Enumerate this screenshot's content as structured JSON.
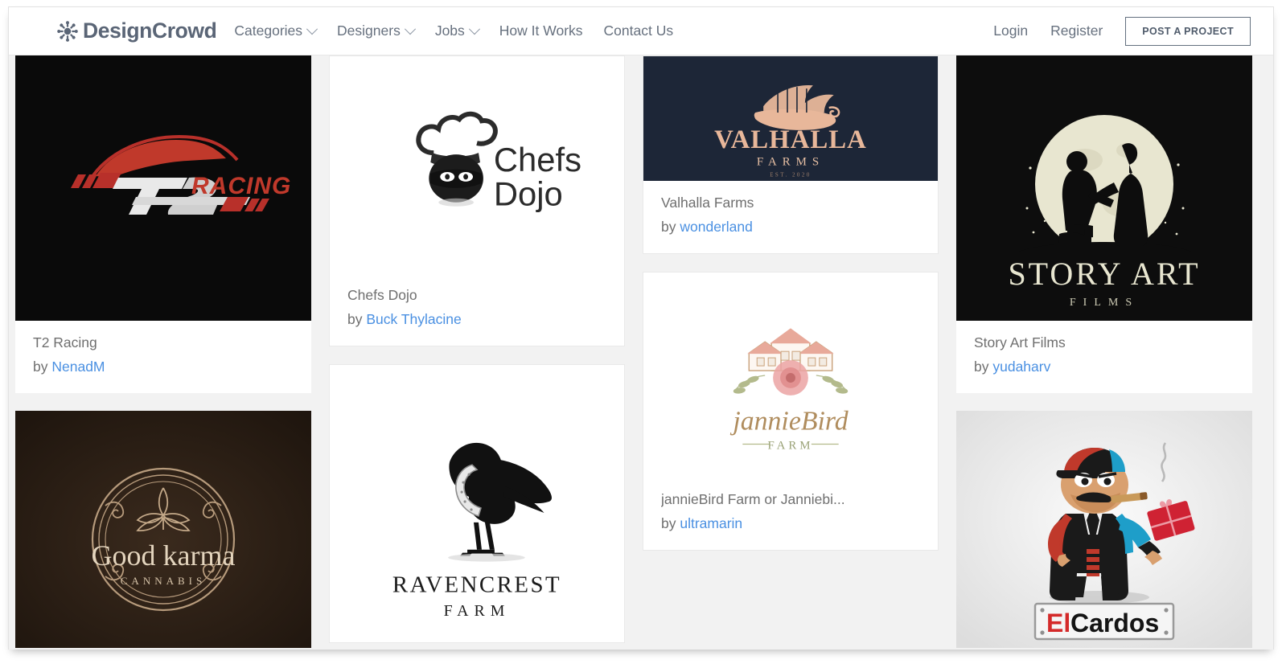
{
  "header": {
    "brand_name": "DesignCrowd",
    "brand_icon": "starburst-people-icon",
    "nav": [
      {
        "label": "Categories",
        "has_dropdown": true
      },
      {
        "label": "Designers",
        "has_dropdown": true
      },
      {
        "label": "Jobs",
        "has_dropdown": true
      },
      {
        "label": "How It Works",
        "has_dropdown": false
      },
      {
        "label": "Contact Us",
        "has_dropdown": false
      }
    ],
    "login_label": "Login",
    "register_label": "Register",
    "post_project_label": "POST A PROJECT"
  },
  "colors": {
    "page_background": "#f2f2f2",
    "card_background": "#ffffff",
    "header_text": "#66707e",
    "brand_text": "#5a6576",
    "link_blue": "#4a90e2",
    "caption_text": "#6f6f6f",
    "button_border": "#63707f"
  },
  "gallery": {
    "by_prefix": "by",
    "columns": [
      {
        "cards": [
          {
            "title": "T2 Racing",
            "designer": "NenadM",
            "logo_art": "t2-racing-logo",
            "thumb_background": "#0a0a0a",
            "thumb_height": 330,
            "show_caption": true
          },
          {
            "title": "Good Karma Cannabis",
            "designer": "",
            "logo_art": "good-karma-cannabis-logo",
            "thumb_background": "#2a1d14",
            "thumb_height": 295,
            "show_caption": false
          }
        ]
      },
      {
        "cards": [
          {
            "title": "Chefs Dojo",
            "designer": "Buck Thylacine",
            "logo_art": "chefs-dojo-logo",
            "thumb_background": "#ffffff",
            "thumb_height": 270,
            "show_caption": true
          },
          {
            "title": "Ravencrest Farm",
            "designer": "",
            "logo_art": "ravencrest-farm-logo",
            "thumb_background": "#ffffff",
            "thumb_height": 345,
            "show_caption": false
          }
        ]
      },
      {
        "cards": [
          {
            "title": "Valhalla Farms",
            "designer": "wonderland",
            "logo_art": "valhalla-farms-logo",
            "thumb_background": "#1d2637",
            "thumb_height": 155,
            "show_caption": true
          },
          {
            "title": "jannieBird Farm or Janniebi...",
            "designer": "ultramarin",
            "logo_art": "janniebird-farm-logo",
            "thumb_background": "#ffffff",
            "thumb_height": 255,
            "show_caption": true
          }
        ]
      },
      {
        "cards": [
          {
            "title": "Story Art Films",
            "designer": "yudaharv",
            "logo_art": "story-art-films-logo",
            "thumb_background": "#0d0d0d",
            "thumb_height": 330,
            "show_caption": true
          },
          {
            "title": "El Cardos",
            "designer": "",
            "logo_art": "el-cardos-logo",
            "thumb_background": "#efefef",
            "thumb_height": 295,
            "show_caption": false
          }
        ]
      }
    ]
  },
  "logo_texts": {
    "t2_racing": {
      "mark": "T2",
      "word": "RACING"
    },
    "chefs_dojo": {
      "line1": "Chefs",
      "line2": "Dojo"
    },
    "valhalla": {
      "name": "VALHALLA",
      "sub": "FARMS",
      "est": "EST. 2020"
    },
    "story_art": {
      "name": "STORY ART",
      "sub": "FILMS"
    },
    "janniebird": {
      "name": "jannieBird",
      "sub": "FARM"
    },
    "good_karma": {
      "name1": "Good",
      "name2": "karma",
      "sub": "CANNABIS"
    },
    "ravencrest": {
      "name": "RAVENCREST",
      "sub": "FARM"
    },
    "el_cardos": {
      "part1": "El",
      "part2": "Cardos"
    }
  }
}
